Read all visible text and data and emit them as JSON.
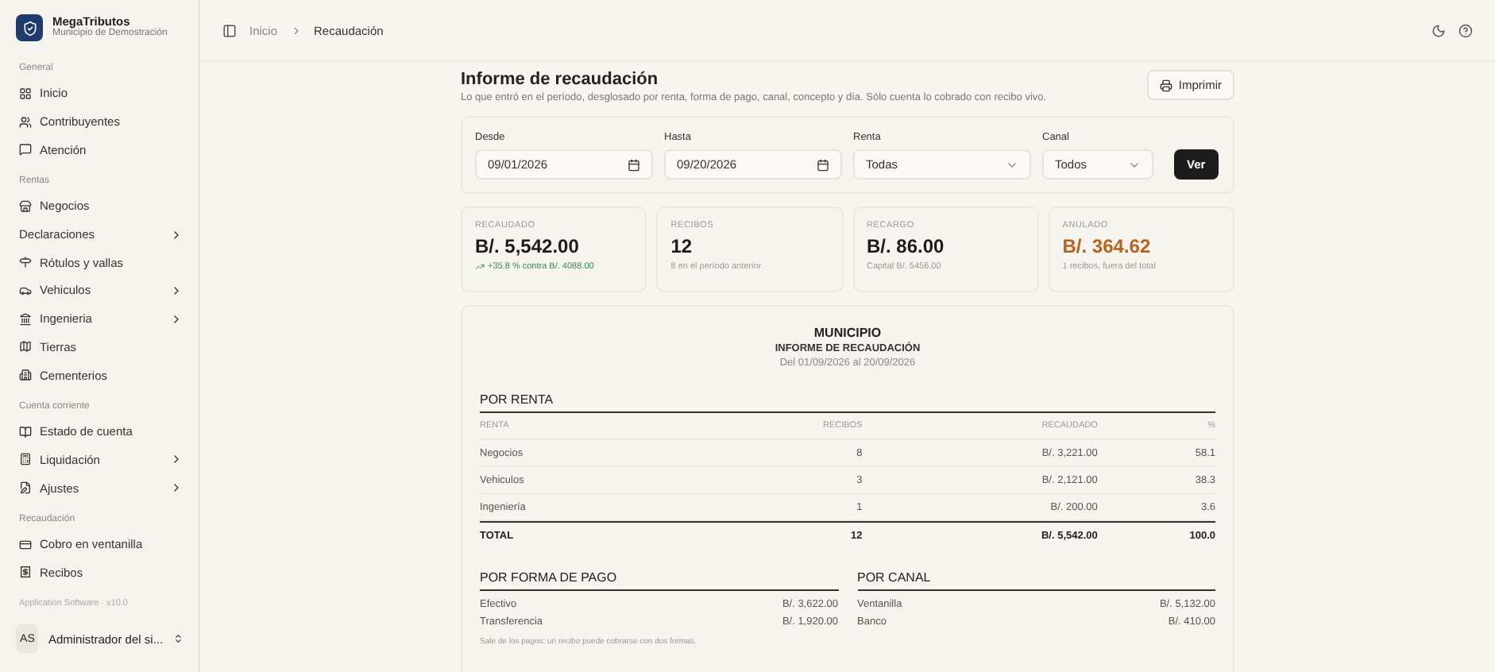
{
  "sidebar": {
    "brand": {
      "name": "MegaTributos",
      "subtitle": "Municipio de Demostración"
    },
    "sections": [
      {
        "label": "General",
        "items": [
          {
            "label": "Inicio",
            "expandable": false
          },
          {
            "label": "Contribuyentes",
            "expandable": false
          },
          {
            "label": "Atención",
            "expandable": false
          }
        ]
      },
      {
        "label": "Rentas",
        "items": [
          {
            "label": "Negocios",
            "expandable": false
          },
          {
            "label": "Declaraciones",
            "expandable": true
          },
          {
            "label": "Rótulos y vallas",
            "expandable": false
          },
          {
            "label": "Vehiculos",
            "expandable": true
          },
          {
            "label": "Ingenieria",
            "expandable": true
          },
          {
            "label": "Tierras",
            "expandable": false
          },
          {
            "label": "Cementerios",
            "expandable": false
          }
        ]
      },
      {
        "label": "Cuenta corriente",
        "items": [
          {
            "label": "Estado de cuenta",
            "expandable": false
          },
          {
            "label": "Liquidación",
            "expandable": true
          },
          {
            "label": "Ajustes",
            "expandable": true
          }
        ]
      },
      {
        "label": "Recaudación",
        "items": [
          {
            "label": "Cobro en ventanilla",
            "expandable": false
          },
          {
            "label": "Recibos",
            "expandable": false
          }
        ]
      }
    ],
    "footer_note": "Application Software · v10.0",
    "user": {
      "initials": "AS",
      "name": "Administrador del si..."
    }
  },
  "breadcrumb": [
    "Inicio",
    "Recaudación"
  ],
  "header": {
    "title": "Informe de recaudación",
    "subtitle": "Lo que entró en el período, desglosado por renta, forma de pago, canal, concepto y día. Sólo cuenta lo cobrado con recibo vivo.",
    "print_button": "Imprimir"
  },
  "filters": [
    {
      "label": "Desde",
      "kind": "date",
      "value": "09/01/2026"
    },
    {
      "label": "Hasta",
      "kind": "date",
      "value": "09/20/2026"
    },
    {
      "label": "Renta",
      "kind": "select",
      "value": "Todas"
    },
    {
      "label": "Canal",
      "kind": "select",
      "value": "Todos"
    }
  ],
  "submit_button": "Ver",
  "stats": [
    {
      "label": "RECAUDADO",
      "value": "B/. 5,542.00",
      "note": "+35.8 % contra B/. 4088.00",
      "trending_up": true,
      "alert": false
    },
    {
      "label": "RECIBOS",
      "value": "12",
      "note": "8 en el período anterior",
      "trending_up": false,
      "alert": false
    },
    {
      "label": "RECARGO",
      "value": "B/. 86.00",
      "note": "Capital B/. 5456.00",
      "trending_up": false,
      "alert": false
    },
    {
      "label": "ANULADO",
      "value": "B/. 364.62",
      "note": "1 recibos, fuera del total",
      "trending_up": false,
      "alert": true
    }
  ],
  "report": {
    "org": "MUNICIPIO",
    "title": "INFORME DE RECAUDACIÓN",
    "period": "Del 01/09/2026 al 20/09/2026",
    "by_rent": {
      "heading": "POR RENTA",
      "columns": [
        "RENTA",
        "RECIBOS",
        "RECAUDADO",
        "%"
      ],
      "rows": [
        [
          "Negocios",
          "8",
          "B/. 3,221.00",
          "58.1"
        ],
        [
          "Vehiculos",
          "3",
          "B/. 2,121.00",
          "38.3"
        ],
        [
          "Ingeniería",
          "1",
          "B/. 200.00",
          "3.6"
        ]
      ],
      "total": [
        "TOTAL",
        "12",
        "B/. 5,542.00",
        "100.0"
      ]
    },
    "by_payment": {
      "heading": "POR FORMA DE PAGO",
      "rows": [
        [
          "Efectivo",
          "B/. 3,622.00"
        ],
        [
          "Transferencia",
          "B/. 1,920.00"
        ]
      ],
      "note": "Sale de los pagos: un recibo puede cobrarse con dos formas."
    },
    "by_channel": {
      "heading": "POR CANAL",
      "rows": [
        [
          "Ventanilla",
          "B/. 5,132.00"
        ],
        [
          "Banco",
          "B/. 410.00"
        ]
      ]
    }
  }
}
